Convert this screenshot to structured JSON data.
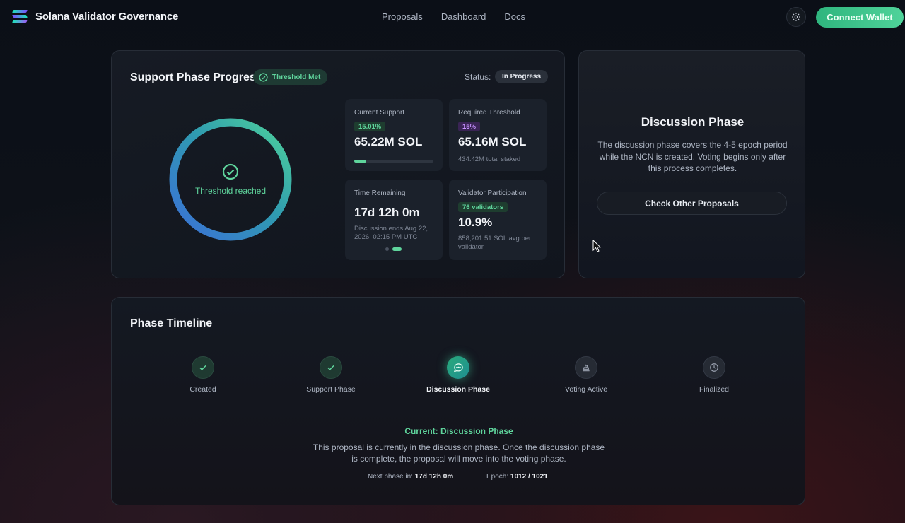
{
  "header": {
    "brand": "Solana Validator Governance",
    "nav": [
      "Proposals",
      "Dashboard",
      "Docs"
    ],
    "connect_label": "Connect Wallet"
  },
  "support": {
    "title": "Support Phase Progress",
    "threshold_badge": "Threshold Met",
    "status_label": "Status:",
    "status_value": "In Progress",
    "ring_label": "Threshold reached",
    "ring_fill_fraction": 1.0,
    "stats": [
      {
        "title": "Current Support",
        "badge": "15.01%",
        "value": "65.22M SOL",
        "progress_fraction": 0.15
      },
      {
        "title": "Required Threshold",
        "badge": "15%",
        "value": "65.16M SOL",
        "sub": "434.42M total staked"
      },
      {
        "title": "Time Remaining",
        "value": "17d 12h 0m",
        "sub": "Discussion ends Aug 22, 2026, 02:15 PM UTC"
      },
      {
        "title": "Validator Participation",
        "badge": "76 validators",
        "value": "10.9%",
        "sub": "858,201.51 SOL avg per validator"
      }
    ]
  },
  "discussion": {
    "title": "Discussion Phase",
    "body": "The discussion phase covers the 4-5 epoch period while the NCN is created. Voting begins only after this process completes.",
    "button": "Check Other Proposals"
  },
  "timeline": {
    "title": "Phase Timeline",
    "steps": [
      {
        "label": "Created",
        "state": "done",
        "icon": "check-icon"
      },
      {
        "label": "Support Phase",
        "state": "done",
        "icon": "check-icon"
      },
      {
        "label": "Discussion Phase",
        "state": "current",
        "icon": "chat-bubble-icon"
      },
      {
        "label": "Voting Active",
        "state": "future",
        "icon": "vote-icon"
      },
      {
        "label": "Finalized",
        "state": "future",
        "icon": "clock-icon"
      }
    ],
    "current_title": "Current: Discussion Phase",
    "current_desc": "This proposal is currently in the discussion phase. Once the discussion phase is complete, the proposal will move into the voting phase.",
    "next_label": "Next phase in:",
    "next_value": "17d 12h 0m",
    "epoch_label": "Epoch:",
    "epoch_value": "1012 / 1021"
  },
  "colors": {
    "accent_green": "#5fd49c",
    "accent_purple": "#c792ff",
    "ring_gradient_start": "#3b6fd8",
    "ring_gradient_end": "#4fd39a"
  }
}
